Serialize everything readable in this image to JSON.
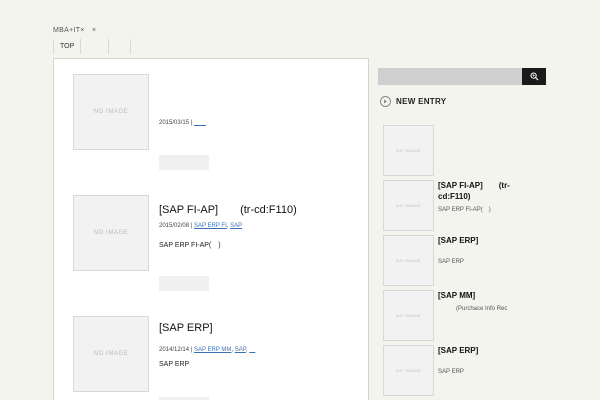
{
  "site": {
    "title": "MBA+IT×　×"
  },
  "nav": {
    "items": [
      "TOP",
      "",
      ""
    ]
  },
  "posts": [
    {
      "thumb": "NO IMAGE",
      "title": "",
      "date": "2015/03/15",
      "categories": [
        "　　"
      ],
      "excerpt": ""
    },
    {
      "thumb": "NO IMAGE",
      "title": "[SAP FI-AP]　　(tr-cd:F110)",
      "date": "2015/02/08",
      "categories": [
        "SAP ERP FI",
        "SAP"
      ],
      "excerpt": "SAP ERP FI-AP(　)"
    },
    {
      "thumb": "NO IMAGE",
      "title": "[SAP ERP]",
      "date": "2014/12/14",
      "categories": [
        "SAP ERP MM",
        "SAP",
        "　"
      ],
      "excerpt": "SAP ERP"
    }
  ],
  "search": {
    "placeholder": ""
  },
  "sidebar": {
    "heading": "NEW ENTRY",
    "entries": [
      {
        "thumb": "NO IMAGE",
        "title": "",
        "sub": ""
      },
      {
        "thumb": "NO IMAGE",
        "title": "[SAP FI-AP]　　(tr-\ncd:F110)",
        "sub": "SAP ERP FI-AP(　)"
      },
      {
        "thumb": "NO IMAGE",
        "title": "[SAP ERP]",
        "sub": "SAP ERP"
      },
      {
        "thumb": "NO IMAGE",
        "title": "[SAP MM]",
        "sub": "　　　(Purchace Info Rec"
      },
      {
        "thumb": "NO IMAGE",
        "title": "[SAP ERP]",
        "sub": "SAP ERP"
      }
    ]
  },
  "icons": {
    "search": "search-icon",
    "entry": "arrow-circle-icon"
  }
}
